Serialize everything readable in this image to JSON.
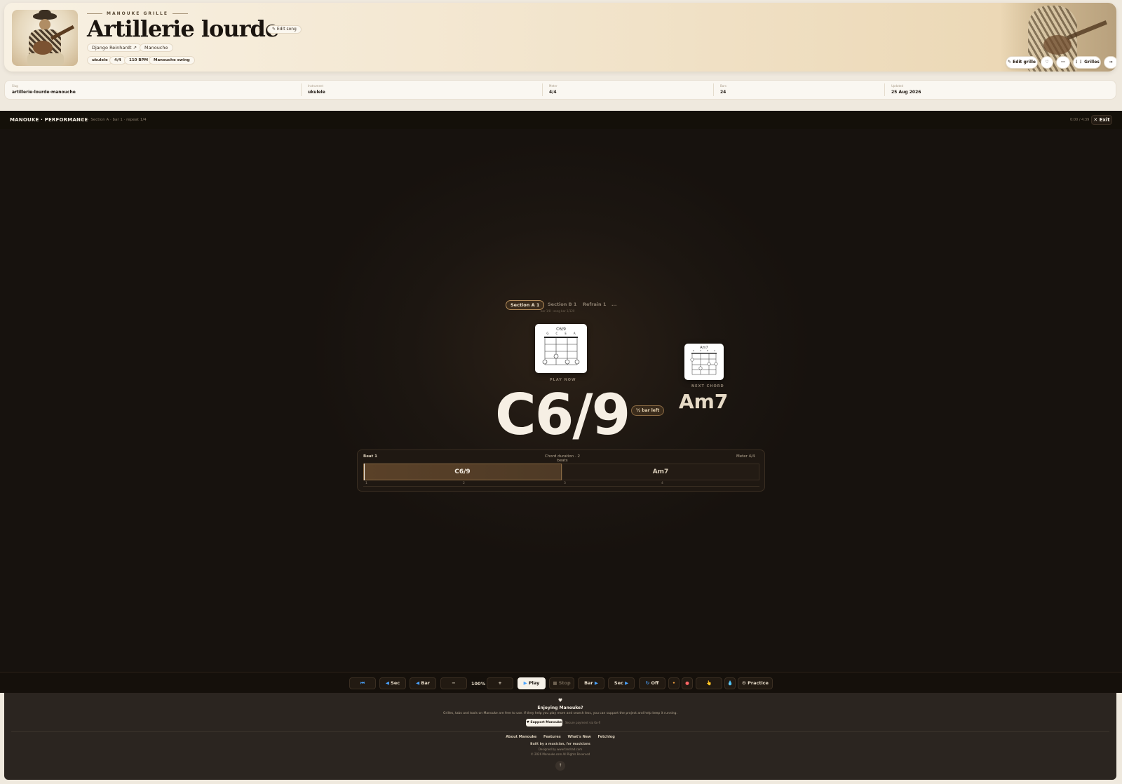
{
  "header": {
    "eyebrow": "MANOUKE GRILLE",
    "title": "Artillerie lourde",
    "info_icon": "info-icon",
    "edit_song_label": "✎ Edit song",
    "artist": "Django Reinhardt",
    "genre": "Manouche",
    "tags": [
      "ukulele",
      "4/4",
      "110 BPM",
      "Manouche swing"
    ],
    "buttons": {
      "edit_grille": "✎ Edit grille",
      "heart": "♡",
      "more": "⋯",
      "grilles": "⋮⋮ Grilles",
      "next": "→"
    }
  },
  "meta": [
    {
      "key": "Slug",
      "value": "artillerie-lourde-manouche"
    },
    {
      "key": "Instrument",
      "value": "ukulele"
    },
    {
      "key": "Meter",
      "value": "4/4"
    },
    {
      "key": "Bars",
      "value": "24"
    },
    {
      "key": "Updated",
      "value": "25 Aug 2026"
    }
  ],
  "performance": {
    "brand": "MANOUKE · PERFORMANCE",
    "breadcrumb": "#1 · Section A · bar 1 · repeat 1/4",
    "time": "0:00 / 4:39",
    "exit_label": "✕ Exit",
    "sections": [
      "Section A 1",
      "Section B 1",
      "Refrain 1",
      "..."
    ],
    "active_section": 0,
    "bar_info": "bar 1/8 · song bar 1/120",
    "current": {
      "chord": "C6/9",
      "diagram_name": "C6/9",
      "strings": [
        "G",
        "C",
        "E",
        "A"
      ],
      "label": "PLAY NOW",
      "bar_left": "½ bar left"
    },
    "next": {
      "chord": "Am7",
      "diagram_name": "Am7",
      "strings": [
        "G",
        "C",
        "E",
        "A"
      ],
      "label": "NEXT CHORD"
    },
    "beat": {
      "label": "Beat 1",
      "duration": "Chord duration · 2 beats",
      "meter": "Meter 4/4",
      "segments": [
        "C6/9",
        "Am7"
      ],
      "ticks": [
        "1",
        "2",
        "3",
        "4"
      ]
    },
    "transport": {
      "first": "⏮",
      "sec_back": "Sec",
      "bar_back": "Bar",
      "minus": "−",
      "zoom": "100%",
      "plus": "+",
      "play": "Play",
      "stop": "Stop",
      "bar_fwd": "Bar",
      "sec_fwd": "Sec",
      "loop": "Off",
      "metronome": "•",
      "record": "●",
      "tap": "👆",
      "drop": "💧",
      "practice": "⚙ Practice"
    }
  },
  "footer": {
    "heart": "♥",
    "title": "Enjoying Manouke?",
    "body": "Grilles, tabs and tools on Manouke are free to use. If they help you play more and search less, you can support the project and help keep it running.",
    "support_label": "♥ Support Manouke",
    "secure": "Secure payment via Ko-fi",
    "links": [
      "About Manouke",
      "Features",
      "What's New",
      "Fetchlog"
    ],
    "built": "Built by a musician, for musicians",
    "designed": "Designed by www.fandrad.com",
    "copyright": "© 2026 Manouke.com All Rights Reserved"
  }
}
